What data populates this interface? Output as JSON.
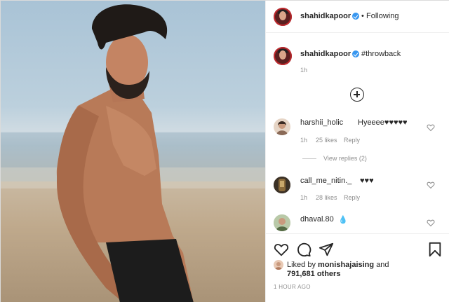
{
  "post": {
    "author": "shahidkapoor",
    "follow_separator": "•",
    "follow_status": "Following",
    "caption_hashtag": "#throwback",
    "caption_age": "1h"
  },
  "comments": [
    {
      "user": "harshii_holic",
      "text": "Hyeeee♥♥♥♥♥",
      "age": "1h",
      "likes": "25 likes",
      "reply": "Reply",
      "view_replies": "View replies (2)"
    },
    {
      "user": "call_me_nitin._",
      "text": "♥♥♥",
      "age": "1h",
      "likes": "28 likes",
      "reply": "Reply"
    },
    {
      "user": "dhaval.80",
      "text": "💧"
    }
  ],
  "footer": {
    "liked_by_prefix": "Liked by",
    "liked_by_user": "monishajaising",
    "liked_by_and": "and",
    "others_count": "791,681 others",
    "timestamp": "1 HOUR AGO"
  },
  "icons": [
    "verified-badge-icon",
    "add-comments-icon",
    "heart-icon",
    "comment-icon",
    "share-icon",
    "bookmark-icon"
  ],
  "colors": {
    "link": "#00376b",
    "verified": "#3897f0",
    "muted": "#8e8e8e",
    "text": "#262626"
  }
}
